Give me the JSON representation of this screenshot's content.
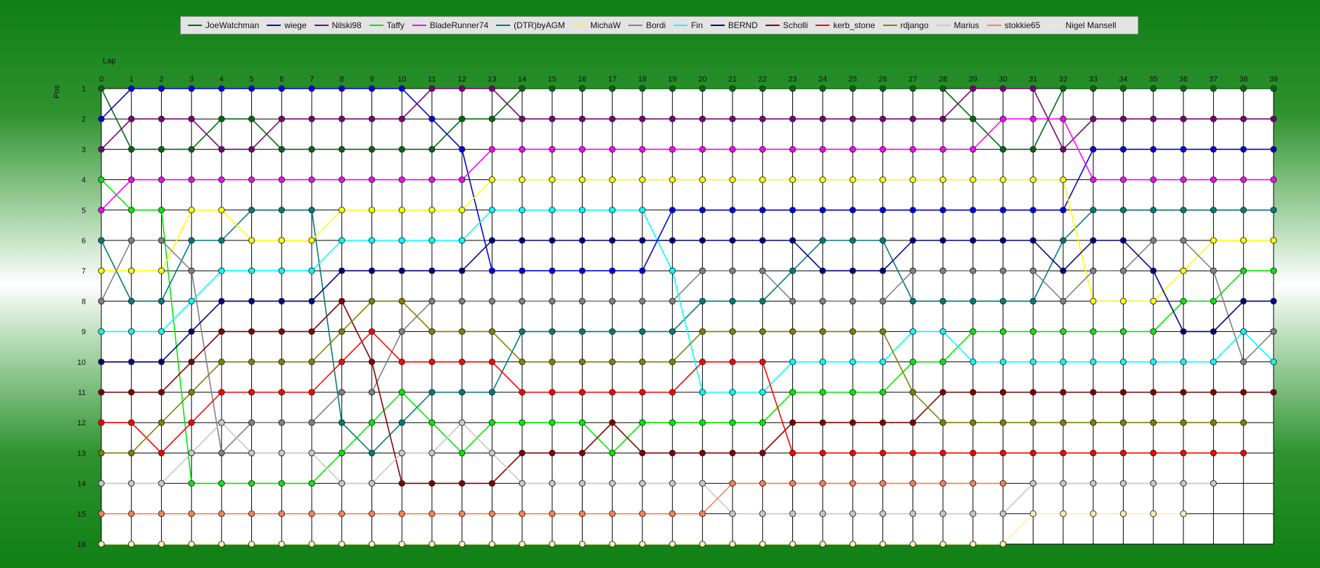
{
  "chart_data": {
    "type": "line",
    "title": "",
    "xlabel": "Lap",
    "ylabel": "Pos",
    "x": [
      0,
      1,
      2,
      3,
      4,
      5,
      6,
      7,
      8,
      9,
      10,
      11,
      12,
      13,
      14,
      15,
      16,
      17,
      18,
      19,
      20,
      21,
      22,
      23,
      24,
      25,
      26,
      27,
      28,
      29,
      30,
      31,
      32,
      33,
      34,
      35,
      36,
      37,
      38,
      39
    ],
    "yticks": [
      1,
      2,
      3,
      4,
      5,
      6,
      7,
      8,
      9,
      10,
      11,
      12,
      13,
      14,
      15,
      16
    ],
    "xlim": [
      0,
      39
    ],
    "ylim": [
      1,
      16
    ],
    "y_inverted": true,
    "grid": true,
    "legend_position": "top",
    "background": "#ffffff",
    "series": [
      {
        "name": "JoeWatchman",
        "color": "#00690e",
        "values": [
          1,
          3,
          3,
          3,
          2,
          2,
          3,
          3,
          3,
          3,
          3,
          3,
          2,
          2,
          1,
          1,
          1,
          1,
          1,
          1,
          1,
          1,
          1,
          1,
          1,
          1,
          1,
          1,
          1,
          2,
          3,
          3,
          1,
          1,
          1,
          1,
          1,
          1,
          1,
          1
        ]
      },
      {
        "name": "wiege",
        "color": "#0000e0",
        "values": [
          2,
          1,
          1,
          1,
          1,
          1,
          1,
          1,
          1,
          1,
          1,
          2,
          3,
          7,
          7,
          7,
          7,
          7,
          7,
          5,
          5,
          5,
          5,
          5,
          5,
          5,
          5,
          5,
          5,
          5,
          5,
          5,
          5,
          3,
          3,
          3,
          3,
          3,
          3,
          3
        ]
      },
      {
        "name": "Nilski98",
        "color": "#7a007a",
        "values": [
          3,
          2,
          2,
          2,
          3,
          3,
          2,
          2,
          2,
          2,
          2,
          1,
          1,
          1,
          2,
          2,
          2,
          2,
          2,
          2,
          2,
          2,
          2,
          2,
          2,
          2,
          2,
          2,
          2,
          1,
          1,
          1,
          3,
          2,
          2,
          2,
          2,
          2,
          2,
          2
        ]
      },
      {
        "name": "Taffy",
        "color": "#00ea00",
        "values": [
          4,
          5,
          5,
          14,
          14,
          14,
          14,
          14,
          13,
          12,
          11,
          12,
          13,
          12,
          12,
          12,
          12,
          13,
          12,
          12,
          12,
          12,
          12,
          11,
          11,
          11,
          11,
          10,
          10,
          9,
          9,
          9,
          9,
          9,
          9,
          9,
          8,
          8,
          7,
          7
        ]
      },
      {
        "name": "BladeRunner74",
        "color": "#ff00ff",
        "values": [
          5,
          4,
          4,
          4,
          4,
          4,
          4,
          4,
          4,
          4,
          4,
          4,
          4,
          3,
          3,
          3,
          3,
          3,
          3,
          3,
          3,
          3,
          3,
          3,
          3,
          3,
          3,
          3,
          3,
          3,
          2,
          2,
          2,
          4,
          4,
          4,
          4,
          4,
          4,
          4
        ]
      },
      {
        "name": "(DTR)byAGM",
        "color": "#007a7a",
        "values": [
          6,
          8,
          8,
          6,
          6,
          5,
          5,
          5,
          12,
          13,
          12,
          11,
          11,
          11,
          9,
          9,
          9,
          9,
          9,
          9,
          8,
          8,
          8,
          7,
          6,
          6,
          6,
          8,
          8,
          8,
          8,
          8,
          6,
          5,
          5,
          5,
          5,
          5,
          5,
          5
        ]
      },
      {
        "name": "MichaW",
        "color": "#ffff00",
        "values": [
          7,
          7,
          7,
          5,
          5,
          6,
          6,
          6,
          5,
          5,
          5,
          5,
          5,
          4,
          4,
          4,
          4,
          4,
          4,
          4,
          4,
          4,
          4,
          4,
          4,
          4,
          4,
          4,
          4,
          4,
          4,
          4,
          4,
          8,
          8,
          8,
          7,
          6,
          6,
          6
        ]
      },
      {
        "name": "Bordi",
        "color": "#808080",
        "values": [
          8,
          6,
          6,
          7,
          13,
          12,
          12,
          12,
          11,
          11,
          9,
          8,
          8,
          8,
          8,
          8,
          8,
          8,
          8,
          8,
          7,
          7,
          7,
          8,
          8,
          8,
          8,
          7,
          7,
          7,
          7,
          7,
          8,
          7,
          7,
          6,
          6,
          7,
          10,
          9
        ]
      },
      {
        "name": "Fin",
        "color": "#00ffff",
        "values": [
          9,
          9,
          9,
          8,
          7,
          7,
          7,
          7,
          6,
          6,
          6,
          6,
          6,
          5,
          5,
          5,
          5,
          5,
          5,
          7,
          11,
          11,
          11,
          10,
          10,
          10,
          10,
          9,
          9,
          10,
          10,
          10,
          10,
          10,
          10,
          10,
          10,
          10,
          9,
          10
        ]
      },
      {
        "name": "BERND",
        "color": "#000080",
        "values": [
          10,
          10,
          10,
          9,
          8,
          8,
          8,
          8,
          7,
          7,
          7,
          7,
          7,
          6,
          6,
          6,
          6,
          6,
          6,
          6,
          6,
          6,
          6,
          6,
          7,
          7,
          7,
          6,
          6,
          6,
          6,
          6,
          7,
          6,
          6,
          7,
          9,
          9,
          8,
          8
        ]
      },
      {
        "name": "Scholli",
        "color": "#800000",
        "values": [
          11,
          11,
          11,
          10,
          9,
          9,
          9,
          9,
          8,
          10,
          14,
          14,
          14,
          14,
          13,
          13,
          13,
          12,
          13,
          13,
          13,
          13,
          13,
          12,
          12,
          12,
          12,
          12,
          11,
          11,
          11,
          11,
          11,
          11,
          11,
          11,
          11,
          11,
          11,
          11
        ]
      },
      {
        "name": "kerb_stone",
        "color": "#ff0000",
        "values": [
          12,
          12,
          13,
          12,
          11,
          11,
          11,
          11,
          10,
          9,
          10,
          10,
          10,
          10,
          11,
          11,
          11,
          11,
          11,
          11,
          10,
          10,
          10,
          13,
          13,
          13,
          13,
          13,
          13,
          13,
          13,
          13,
          13,
          13,
          13,
          13,
          13,
          13,
          13,
          null
        ]
      },
      {
        "name": "rdjango",
        "color": "#808000",
        "values": [
          13,
          13,
          12,
          11,
          10,
          10,
          10,
          10,
          9,
          8,
          8,
          9,
          9,
          9,
          10,
          10,
          10,
          10,
          10,
          10,
          9,
          9,
          9,
          9,
          9,
          9,
          9,
          11,
          12,
          12,
          12,
          12,
          12,
          12,
          12,
          12,
          12,
          12,
          12,
          null
        ]
      },
      {
        "name": "Marius",
        "color": "#c8c8c8",
        "values": [
          14,
          14,
          14,
          13,
          12,
          13,
          13,
          13,
          14,
          14,
          13,
          13,
          12,
          13,
          14,
          14,
          14,
          14,
          14,
          14,
          14,
          15,
          15,
          15,
          15,
          15,
          15,
          15,
          15,
          15,
          15,
          14,
          14,
          14,
          14,
          14,
          14,
          14,
          null,
          null
        ]
      },
      {
        "name": "stokkie65",
        "color": "#ff7f50",
        "values": [
          15,
          15,
          15,
          15,
          15,
          15,
          15,
          15,
          15,
          15,
          15,
          15,
          15,
          15,
          15,
          15,
          15,
          15,
          15,
          15,
          15,
          14,
          14,
          14,
          14,
          14,
          14,
          14,
          14,
          14,
          14,
          null,
          null,
          null,
          null,
          null,
          null,
          null,
          null,
          null
        ]
      },
      {
        "name": "Nigel Mansell",
        "color": "#ffebb4",
        "values": [
          16,
          16,
          16,
          16,
          16,
          16,
          16,
          16,
          16,
          16,
          16,
          16,
          16,
          16,
          16,
          16,
          16,
          16,
          16,
          16,
          16,
          16,
          16,
          16,
          16,
          16,
          16,
          16,
          16,
          16,
          16,
          15,
          15,
          15,
          15,
          15,
          15,
          null,
          null,
          null
        ]
      }
    ]
  }
}
